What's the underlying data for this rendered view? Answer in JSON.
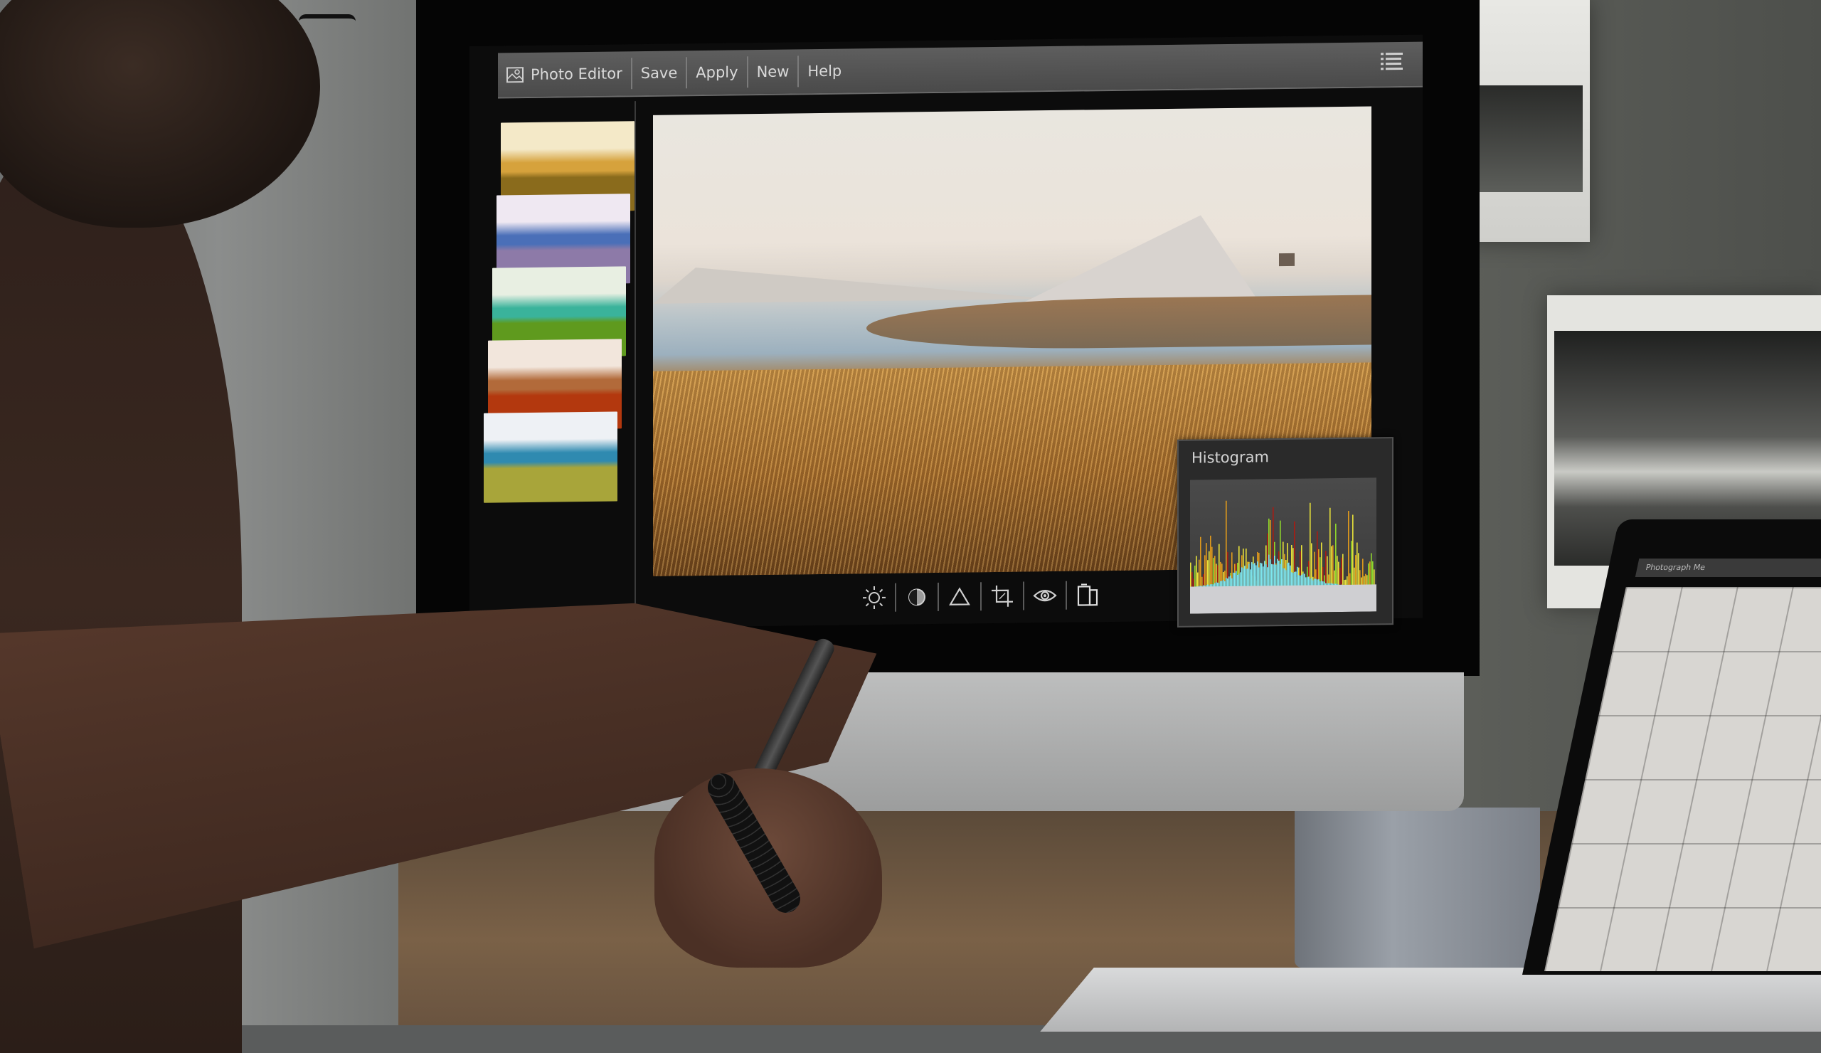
{
  "app": {
    "title": "Photo Editor",
    "accent_color": "#4f4f4f",
    "menu": [
      {
        "label": "Save"
      },
      {
        "label": "Apply"
      },
      {
        "label": "New"
      },
      {
        "label": "Help"
      }
    ],
    "menu_icon": "list-icon"
  },
  "sidebar": {
    "filters": [
      {
        "name": "warm-gold",
        "colors": [
          "#f4e9c8",
          "#d6a23c",
          "#8a6b1c"
        ]
      },
      {
        "name": "purple-blue",
        "colors": [
          "#efe8f2",
          "#4a6fb8",
          "#8d7aa8"
        ]
      },
      {
        "name": "green",
        "colors": [
          "#e8efe2",
          "#3ab39b",
          "#5f9a1e"
        ]
      },
      {
        "name": "red-orange",
        "colors": [
          "#f2e6dc",
          "#b26a3a",
          "#b3380e"
        ]
      },
      {
        "name": "teal-yellow",
        "colors": [
          "#eef1f5",
          "#2f8ab0",
          "#a8a53a"
        ]
      }
    ]
  },
  "histogram": {
    "title": "Histogram",
    "channel_colors": {
      "luminance": "#cfcfd2",
      "cyan": "#7ee6f0",
      "yellow": "#e8e23a",
      "orange": "#e09a1c",
      "red": "#a81c14",
      "green": "#8ed62c"
    }
  },
  "toolbar": {
    "tools": [
      {
        "name": "brightness",
        "icon": "sun-icon"
      },
      {
        "name": "contrast",
        "icon": "contrast-icon"
      },
      {
        "name": "sharpen",
        "icon": "triangle-icon"
      },
      {
        "name": "crop",
        "icon": "crop-icon"
      },
      {
        "name": "preview",
        "icon": "eye-icon"
      },
      {
        "name": "compare",
        "icon": "layers-icon"
      }
    ]
  },
  "laptop": {
    "title": "Photograph Me"
  }
}
